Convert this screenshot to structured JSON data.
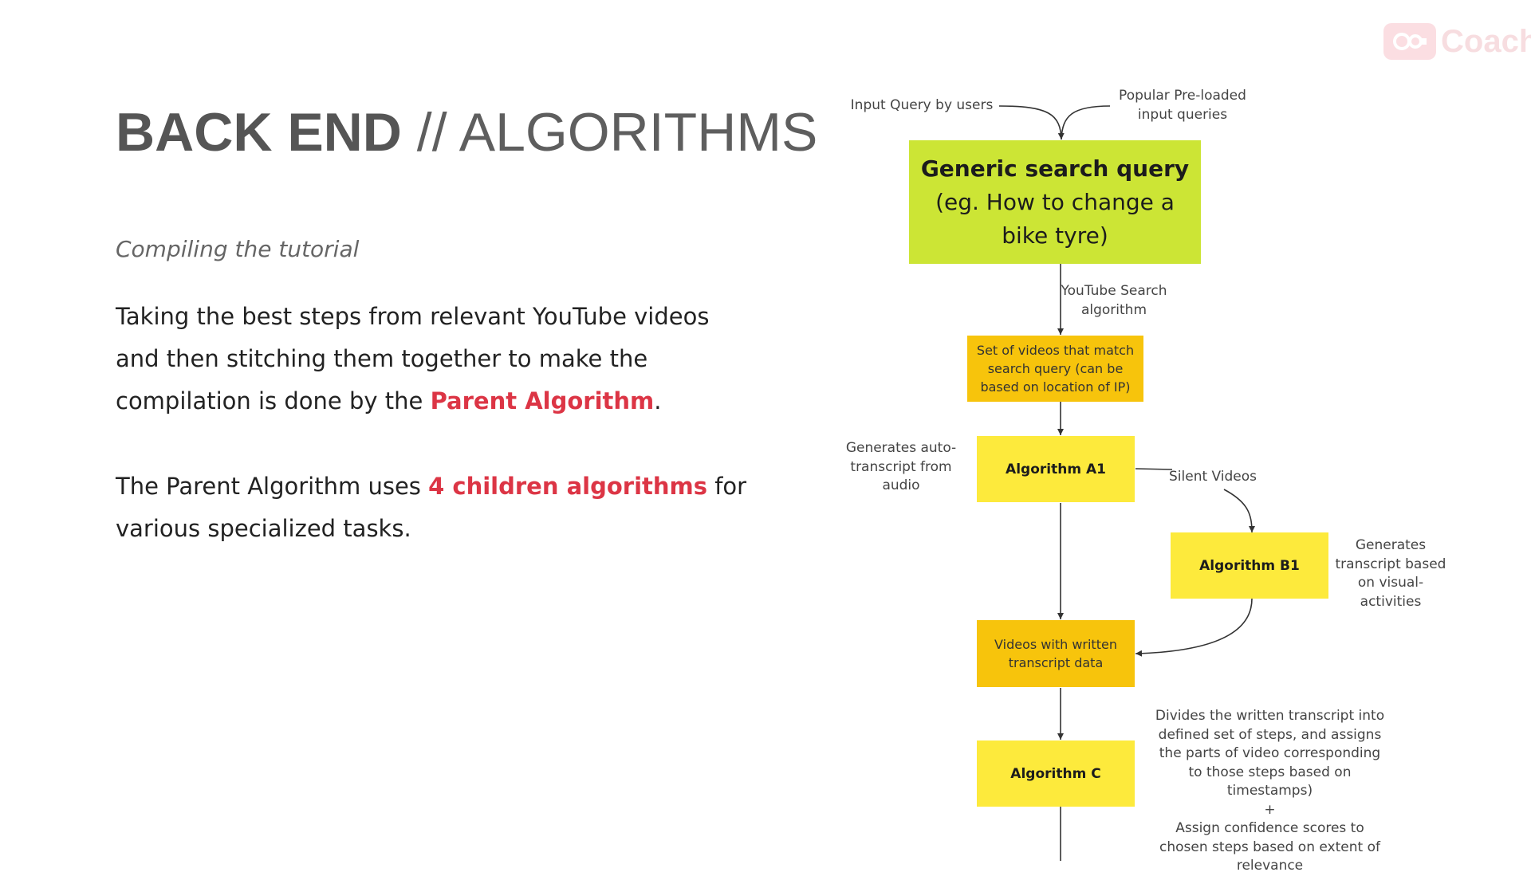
{
  "slide": {
    "title_bold": "BACK END",
    "title_light": " // ALGORITHMS",
    "subtitle": "Compiling the tutorial",
    "para1": {
      "before": "Taking the best steps from relevant YouTube videos and then stitching them together to make the compilation is done by the ",
      "highlight": "Parent Algorithm",
      "after": "."
    },
    "para2": {
      "before": "The Parent Algorithm uses ",
      "highlight": "4 children algorithms",
      "after": " for various specialized tasks."
    }
  },
  "logo": {
    "text": "Coach",
    "icon": "camera-reel-icon"
  },
  "colors": {
    "title": "#555555",
    "highlight": "#dc3545",
    "box_green": "#cce535",
    "box_yellow": "#fdea3c",
    "box_orange": "#f7c40c"
  },
  "flowchart": {
    "input_users": "Input Query by users",
    "input_preloaded": "Popular Pre-loaded input queries",
    "generic_query_title": "Generic search query",
    "generic_query_example": "(eg. How to change a bike tyre)",
    "youtube_search_label": "YouTube Search algorithm",
    "set_of_videos": "Set of videos that match search query (can be based on location of IP)",
    "algorithm_a1": "Algorithm A1",
    "a1_note": "Generates auto-transcript from audio",
    "silent_videos_label": "Silent Videos",
    "algorithm_b1": "Algorithm B1",
    "b1_note": "Generates transcript based on visual-activities",
    "videos_with_transcript": "Videos with written transcript data",
    "algorithm_c": "Algorithm C",
    "c_note_part1": "Divides the written transcript into defined set of steps, and assigns the parts of video corresponding to those steps based on timestamps)",
    "c_note_plus": "+",
    "c_note_part2": "Assign confidence scores to chosen steps based on extent of relevance"
  }
}
